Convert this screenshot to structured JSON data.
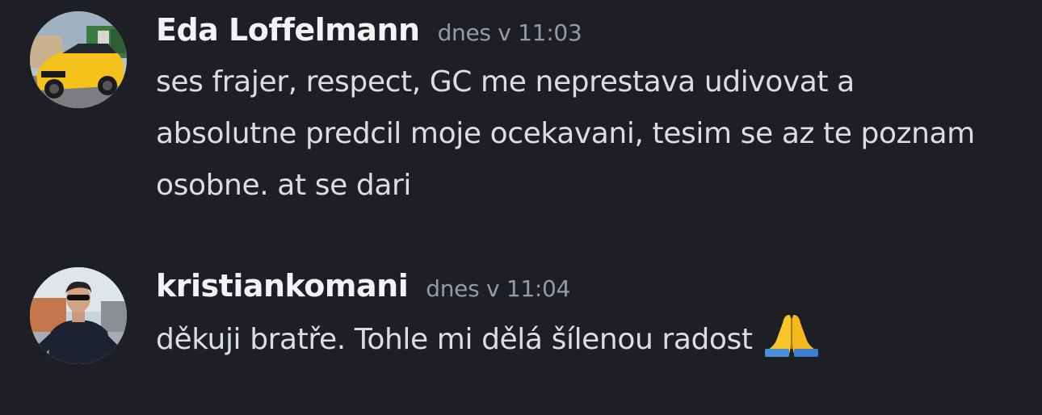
{
  "messages": [
    {
      "username": "Eda Loffelmann",
      "timestamp": "dnes v 11:03",
      "text": "ses frajer, respect, GC me neprestava udivovat a absolutne predcil moje ocekavani, tesim se az te poznam osobne. at se dari",
      "avatar": "car-photo-avatar"
    },
    {
      "username": "kristiankomani",
      "timestamp": "dnes v 11:04",
      "text": "děkuji bratře. Tohle mi dělá šílenou radost",
      "emoji": "folded-hands-emoji",
      "avatar": "person-photo-avatar"
    }
  ],
  "colors": {
    "background": "#1e1f24",
    "username": "#f2f3f5",
    "timestamp": "#949ba4",
    "message_text": "#dbdee1"
  }
}
